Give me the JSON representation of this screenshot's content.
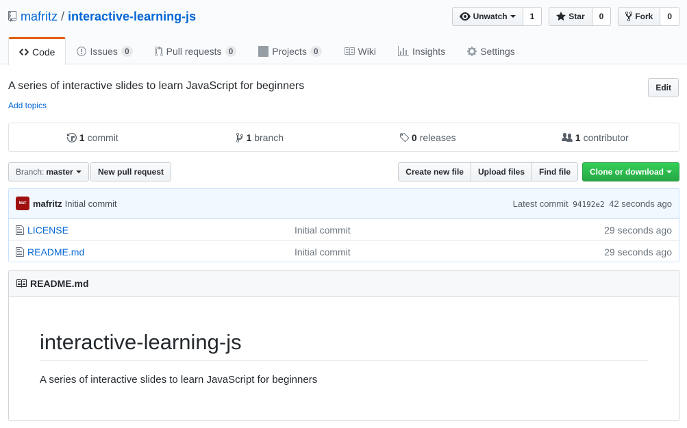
{
  "repo": {
    "owner": "mafritz",
    "separator": "/",
    "name": "interactive-learning-js"
  },
  "actions": {
    "watch_label": "Unwatch",
    "watch_count": "1",
    "star_label": "Star",
    "star_count": "0",
    "fork_label": "Fork",
    "fork_count": "0"
  },
  "nav": {
    "code": "Code",
    "issues": "Issues",
    "issues_count": "0",
    "pulls": "Pull requests",
    "pulls_count": "0",
    "projects": "Projects",
    "projects_count": "0",
    "wiki": "Wiki",
    "insights": "Insights",
    "settings": "Settings"
  },
  "description": "A series of interactive slides to learn JavaScript for beginners",
  "add_topics": "Add topics",
  "edit_label": "Edit",
  "numbers": {
    "commits_num": "1",
    "commits_label": "commit",
    "branches_num": "1",
    "branches_label": "branch",
    "releases_num": "0",
    "releases_label": "releases",
    "contributors_num": "1",
    "contributors_label": "contributor"
  },
  "file_nav": {
    "branch_label": "Branch:",
    "branch_name": "master",
    "new_pr": "New pull request",
    "create_file": "Create new file",
    "upload_files": "Upload files",
    "find_file": "Find file",
    "clone": "Clone or download"
  },
  "commit": {
    "avatar_text": "MAF",
    "author": "mafritz",
    "message": "Initial commit",
    "latest_label": "Latest commit",
    "sha": "94192e2",
    "age": "42 seconds ago"
  },
  "files": [
    {
      "name": "LICENSE",
      "message": "Initial commit",
      "age": "29 seconds ago"
    },
    {
      "name": "README.md",
      "message": "Initial commit",
      "age": "29 seconds ago"
    }
  ],
  "readme": {
    "header": "README.md",
    "title": "interactive-learning-js",
    "body": "A series of interactive slides to learn JavaScript for beginners"
  },
  "colors": {
    "accent": "#0366d6",
    "nav_selected": "#e36209",
    "clone_green": "#28a745"
  }
}
